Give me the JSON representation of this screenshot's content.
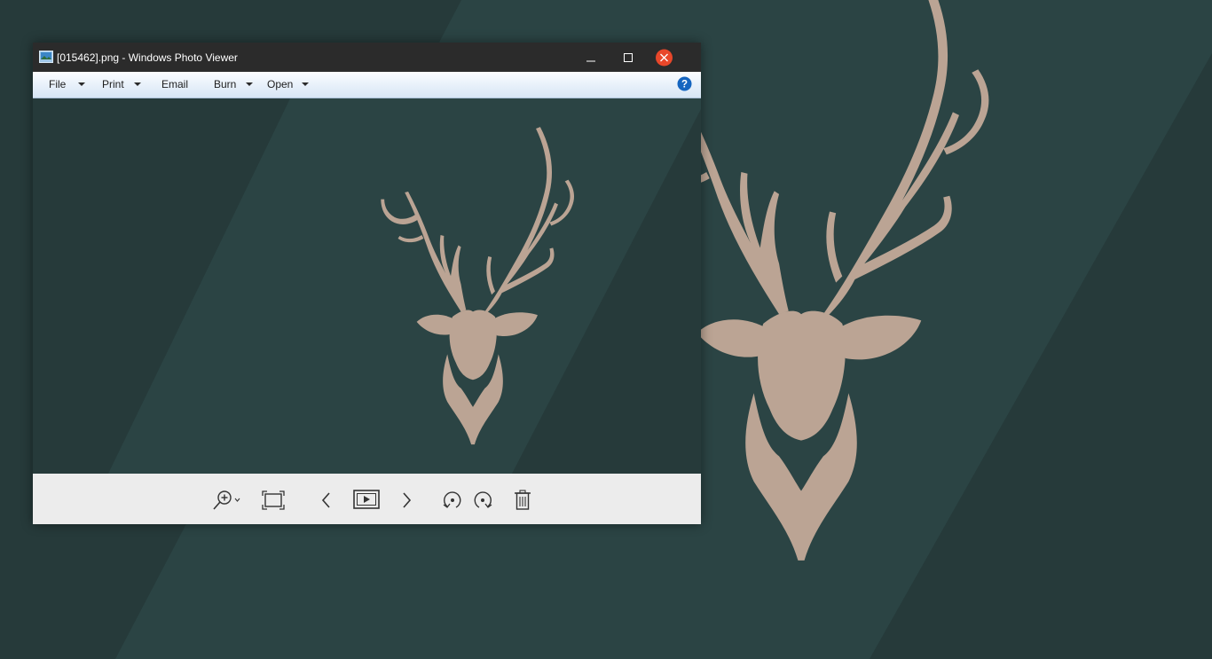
{
  "window": {
    "title": "[015462].png - Windows Photo Viewer"
  },
  "menu": {
    "file": "File",
    "print": "Print",
    "email": "Email",
    "burn": "Burn",
    "open": "Open",
    "help_icon": "help-icon"
  },
  "toolbar": {
    "icons": [
      "zoom-icon",
      "actual-size-icon",
      "previous-icon",
      "slideshow-icon",
      "next-icon",
      "rotate-counterclockwise-icon",
      "rotate-clockwise-icon",
      "delete-icon"
    ]
  },
  "colors": {
    "background": "#263a3a",
    "stripe": "#2b4444",
    "deer": "#bba494",
    "titlebar": "#2b2b2b",
    "close_button": "#e8472a",
    "help_button": "#1565c0"
  }
}
